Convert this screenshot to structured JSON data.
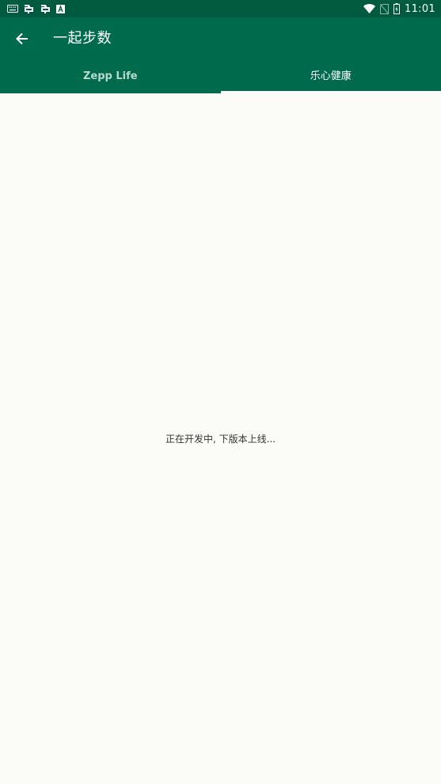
{
  "status_bar": {
    "time": "11:01",
    "left_icons": [
      "keyboard-icon",
      "bug-icon",
      "bug-icon",
      "a-box-icon"
    ],
    "right_icons": [
      "wifi-icon",
      "no-sim-icon",
      "battery-charging-icon"
    ]
  },
  "app_bar": {
    "title": "一起步数",
    "back_icon": "arrow-back-icon",
    "background": "#006a4c"
  },
  "tabs": [
    {
      "label": "Zepp Life",
      "active": false
    },
    {
      "label": "乐心健康",
      "active": true
    }
  ],
  "content": {
    "message": "正在开发中, 下版本上线..."
  },
  "colors": {
    "status_bar": "#005b3e",
    "app_bar": "#006a4c",
    "background": "#fbfcf8",
    "tab_inactive": "#b9d8cc",
    "tab_active": "#ffffff"
  }
}
